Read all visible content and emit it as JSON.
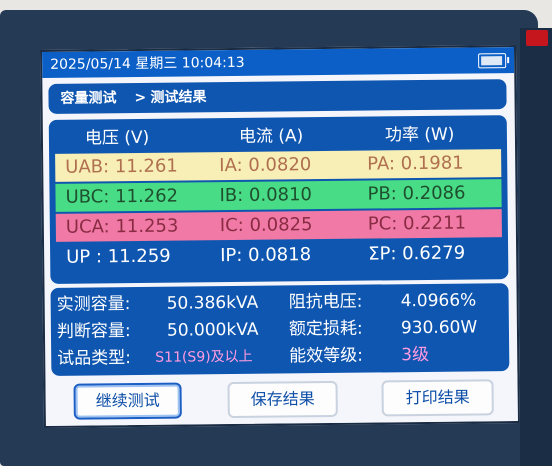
{
  "status": {
    "datetime": "2025/05/14  星期三  10:04:13",
    "battery_icon": "battery-icon"
  },
  "breadcrumb": {
    "parent": "容量测试",
    "separator": ">",
    "current": "测试结果"
  },
  "table": {
    "headers": [
      "电压 (V)",
      "电流 (A)",
      "功率 (W)"
    ],
    "rows": [
      [
        "UAB: 11.261",
        "IA: 0.0820",
        "PA: 0.1981"
      ],
      [
        "UBC: 11.262",
        "IB: 0.0810",
        "PB: 0.2086"
      ],
      [
        "UCA: 11.253",
        "IC: 0.0825",
        "PC: 0.2211"
      ],
      [
        "UP : 11.259",
        "IP: 0.0818",
        "ΣP: 0.6279"
      ]
    ]
  },
  "results": {
    "measured_capacity_label": "实测容量:",
    "measured_capacity_value": "50.386kVA",
    "impedance_voltage_label": "阻抗电压:",
    "impedance_voltage_value": "4.0966%",
    "judged_capacity_label": "判断容量:",
    "judged_capacity_value": "50.000kVA",
    "rated_loss_label": "额定损耗:",
    "rated_loss_value": "930.60W",
    "product_type_label": "试品类型:",
    "product_type_value": "S11(S9)及以上",
    "efficiency_grade_label": "能效等级:",
    "efficiency_grade_value": "3级"
  },
  "buttons": {
    "continue": "继续测试",
    "save": "保存结果",
    "print": "打印结果"
  },
  "colors": {
    "blue_panel": "#0f56b0",
    "row_uab": "#f7efb6",
    "row_ubc": "#49dc86",
    "row_uca": "#f07aa5",
    "highlight_value": "#ff9be0"
  }
}
